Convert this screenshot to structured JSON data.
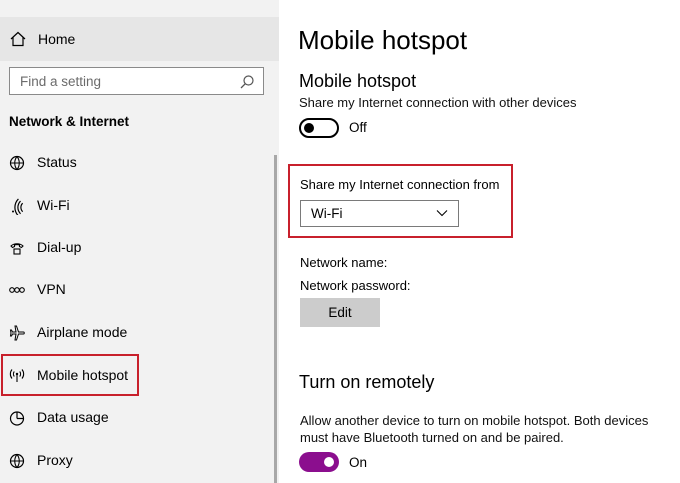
{
  "sidebar": {
    "home_label": "Home",
    "search_placeholder": "Find a setting",
    "section_title": "Network & Internet",
    "items": [
      {
        "label": "Status"
      },
      {
        "label": "Wi-Fi"
      },
      {
        "label": "Dial-up"
      },
      {
        "label": "VPN"
      },
      {
        "label": "Airplane mode"
      },
      {
        "label": "Mobile hotspot"
      },
      {
        "label": "Data usage"
      },
      {
        "label": "Proxy"
      }
    ],
    "selected": "Mobile hotspot"
  },
  "main": {
    "page_title": "Mobile hotspot",
    "hotspot": {
      "title": "Mobile hotspot",
      "description": "Share my Internet connection with other devices",
      "toggle_state": "off",
      "toggle_label": "Off"
    },
    "share_from": {
      "label": "Share my Internet connection from",
      "selected_value": "Wi-Fi"
    },
    "network_name_label": "Network name:",
    "network_password_label": "Network password:",
    "edit_label": "Edit",
    "remote": {
      "title": "Turn on remotely",
      "description": "Allow another device to turn on mobile hotspot. Both devices must have Bluetooth turned on and be paired.",
      "toggle_state": "on",
      "toggle_label": "On"
    }
  },
  "colors": {
    "highlight_border": "#c8202c",
    "toggle_on": "#8b0e8e",
    "sidebar_bg": "#f2f2f2",
    "home_bg": "#e6e6e6"
  }
}
